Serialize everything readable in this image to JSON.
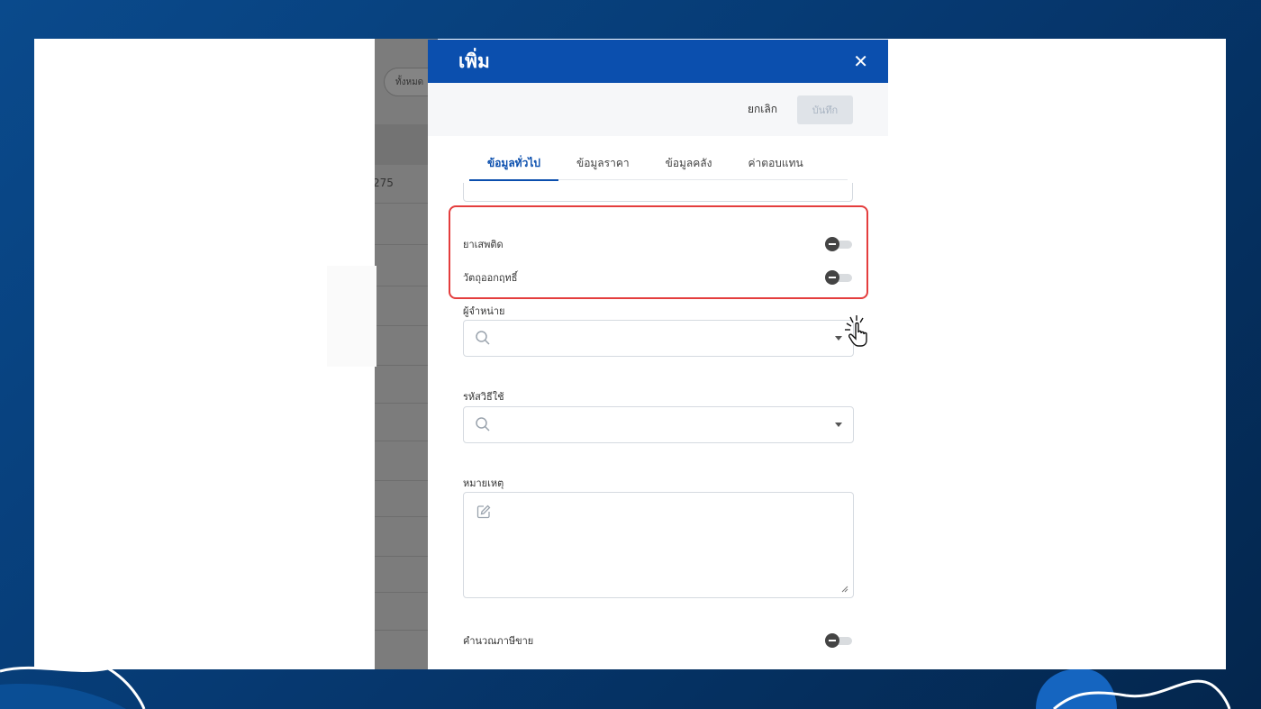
{
  "background_app": {
    "filter_chip": "ทั้งหมด",
    "row_value": "275"
  },
  "modal": {
    "title": "เพิ่ม",
    "close_icon": "close-icon",
    "cancel_label": "ยกเลิก",
    "save_label": "บันทึก",
    "tabs": [
      {
        "label": "ข้อมูลทั่วไป",
        "active": true
      },
      {
        "label": "ข้อมูลราคา",
        "active": false
      },
      {
        "label": "ข้อมูลคลัง",
        "active": false
      },
      {
        "label": "ค่าตอบแทน",
        "active": false
      }
    ],
    "toggles": {
      "narcotic": {
        "label": "ยาเสพติด",
        "on": false
      },
      "psychotropic": {
        "label": "วัตถุออกฤทธิ์",
        "on": false
      },
      "sales_tax": {
        "label": "คำนวณภาษีขาย",
        "on": false
      }
    },
    "fields": {
      "supplier": {
        "label": "ผู้จำหน่าย",
        "value": ""
      },
      "usage_code": {
        "label": "รหัสวิธีใช้",
        "value": ""
      },
      "note": {
        "label": "หมายเหตุ",
        "value": ""
      }
    }
  },
  "colors": {
    "header_blue": "#0b4fae",
    "highlight_red": "#e43d3d",
    "backdrop_navy": "#063a73"
  }
}
